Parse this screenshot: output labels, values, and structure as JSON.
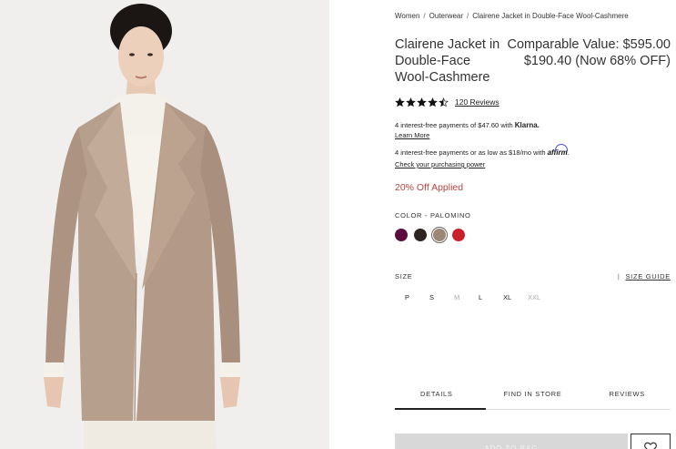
{
  "breadcrumb": {
    "items": [
      "Women",
      "Outerwear",
      "Clairene Jacket in Double-Face Wool-Cashmere"
    ],
    "separator": "/"
  },
  "product": {
    "title": "Clairene Jacket in Double-Face Wool-Cashmere",
    "price_line1": "Comparable Value: $595.00",
    "price_line2": "$190.40 (Now 68% OFF)",
    "rating": 4.5,
    "reviews_label": "120 Reviews"
  },
  "klarna": {
    "text": "4 interest-free payments of $47.60 with",
    "brand": "Klarna.",
    "learn_more": "Learn More"
  },
  "affirm": {
    "text": "4 interest-free payments or as low as $18/mo with",
    "brand": "affirm",
    "suffix": ".",
    "link": "Check your purchasing power"
  },
  "promo": "20% Off Applied",
  "color": {
    "label": "COLOR -",
    "selected": "PALOMINO",
    "swatches": [
      "#5b0e3e",
      "#2e2421",
      "#9c8676",
      "#c8202c"
    ],
    "selected_index": 2
  },
  "size": {
    "label": "SIZE",
    "guide_label": "SIZE GUIDE",
    "options": [
      {
        "label": "P",
        "available": true
      },
      {
        "label": "S",
        "available": true
      },
      {
        "label": "M",
        "available": false
      },
      {
        "label": "L",
        "available": true
      },
      {
        "label": "XL",
        "available": true
      },
      {
        "label": "XXL",
        "available": false
      }
    ]
  },
  "tabs": [
    {
      "label": "DETAILS",
      "active": true
    },
    {
      "label": "FIND IN STORE",
      "active": false
    },
    {
      "label": "REVIEWS",
      "active": false
    }
  ],
  "actions": {
    "add_to_bag": "ADD TO BAG"
  },
  "colors": {
    "promo": "#b8423d",
    "coat": "#b59d8c"
  },
  "icons": {
    "star": "star-icon",
    "wishlist": "heart-icon"
  }
}
